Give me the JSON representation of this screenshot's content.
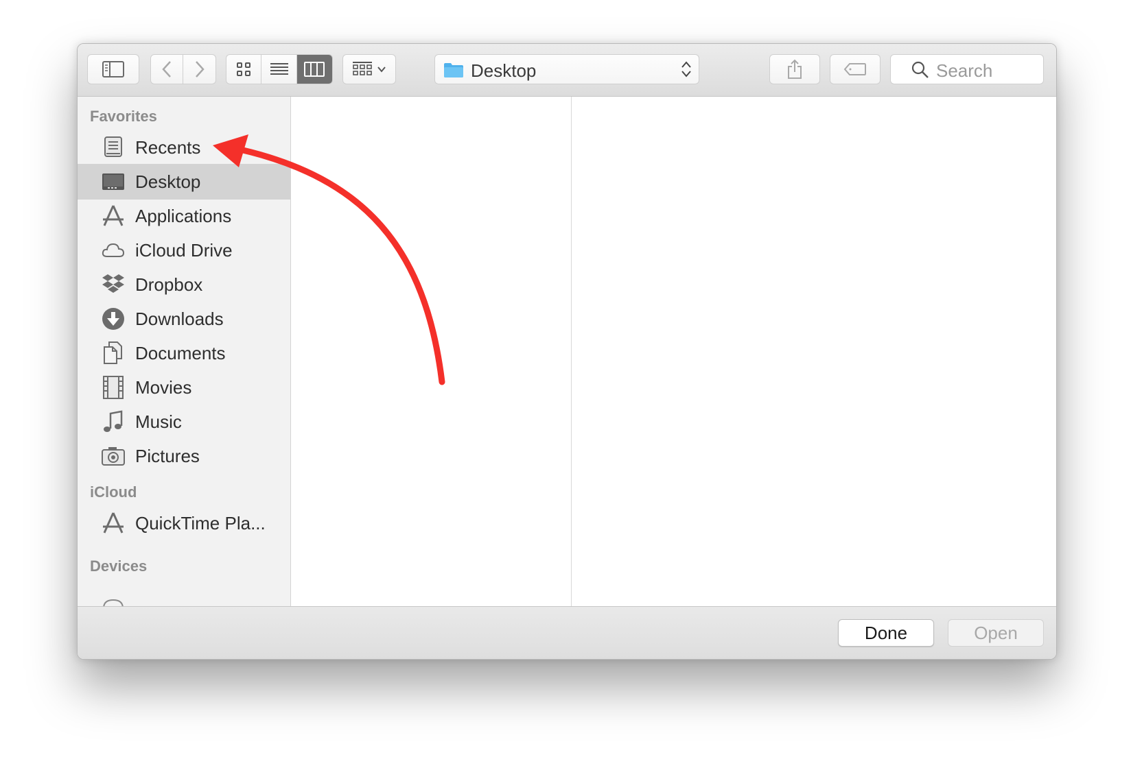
{
  "toolbar": {
    "path_popup_label": "Desktop",
    "search_placeholder": "Search"
  },
  "sidebar": {
    "favorites_title": "Favorites",
    "items": [
      {
        "label": "Recents",
        "icon": "recents-icon"
      },
      {
        "label": "Desktop",
        "icon": "desktop-icon",
        "selected": true
      },
      {
        "label": "Applications",
        "icon": "applications-icon"
      },
      {
        "label": "iCloud Drive",
        "icon": "cloud-icon"
      },
      {
        "label": "Dropbox",
        "icon": "dropbox-icon"
      },
      {
        "label": "Downloads",
        "icon": "downloads-icon"
      },
      {
        "label": "Documents",
        "icon": "documents-icon"
      },
      {
        "label": "Movies",
        "icon": "movies-icon"
      },
      {
        "label": "Music",
        "icon": "music-icon"
      },
      {
        "label": "Pictures",
        "icon": "pictures-icon"
      }
    ],
    "icloud_title": "iCloud",
    "icloud_items": [
      {
        "label": "QuickTime Pla...",
        "icon": "applications-icon"
      }
    ],
    "devices_title": "Devices"
  },
  "footer": {
    "done_label": "Done",
    "open_label": "Open"
  },
  "colors": {
    "annotation_arrow": "#f4302a",
    "folder_blue": "#4fb1ec",
    "selected_row": "#d3d3d3"
  }
}
